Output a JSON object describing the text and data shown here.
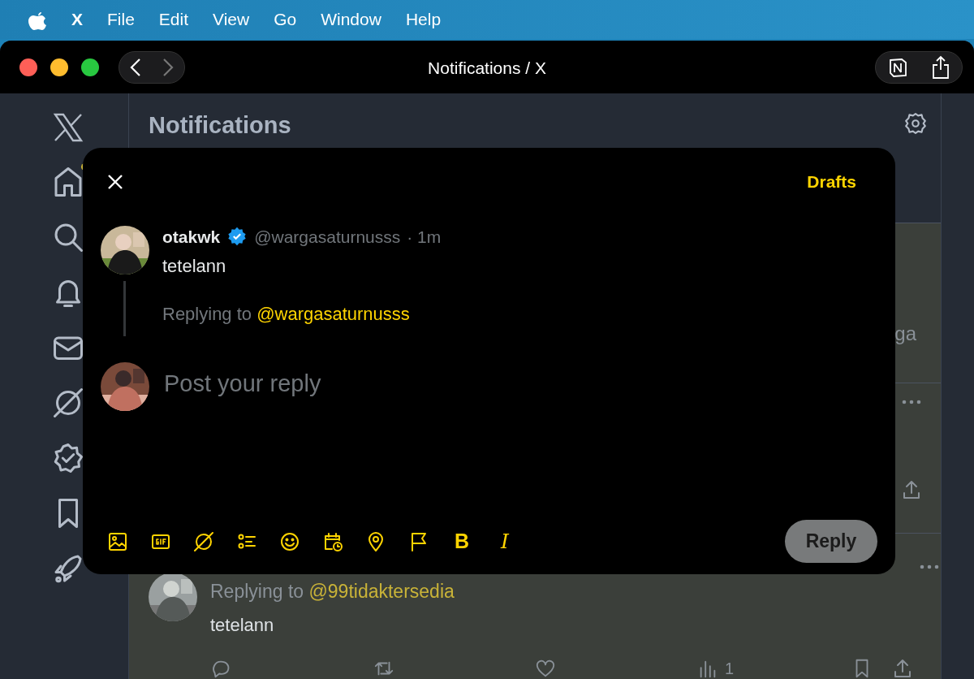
{
  "menubar": {
    "app_name": "X",
    "menus": [
      "File",
      "Edit",
      "View",
      "Go",
      "Window",
      "Help"
    ]
  },
  "window": {
    "title": "Notifications / X"
  },
  "sidebar": {
    "home_unread": true
  },
  "page": {
    "title": "Notifications"
  },
  "background_posts": [
    {
      "kind": "fragment",
      "text": "ga"
    },
    {
      "kind": "actions_only"
    },
    {
      "kind": "reply",
      "replying_prefix": "Replying to",
      "replying_handle": "@99tidaktersedia",
      "text": "tetelann",
      "views": "1"
    }
  ],
  "composer": {
    "drafts": "Drafts",
    "post": {
      "name": "otakwk",
      "verified": true,
      "handle": "@wargasaturnusss",
      "time": "· 1m",
      "text": "tetelann"
    },
    "replying": {
      "prefix": "Replying to",
      "handle": "@wargasaturnusss"
    },
    "placeholder": "Post your reply",
    "format_buttons": [
      "B",
      "I"
    ],
    "reply_button": {
      "label": "Reply",
      "disabled": true
    }
  }
}
